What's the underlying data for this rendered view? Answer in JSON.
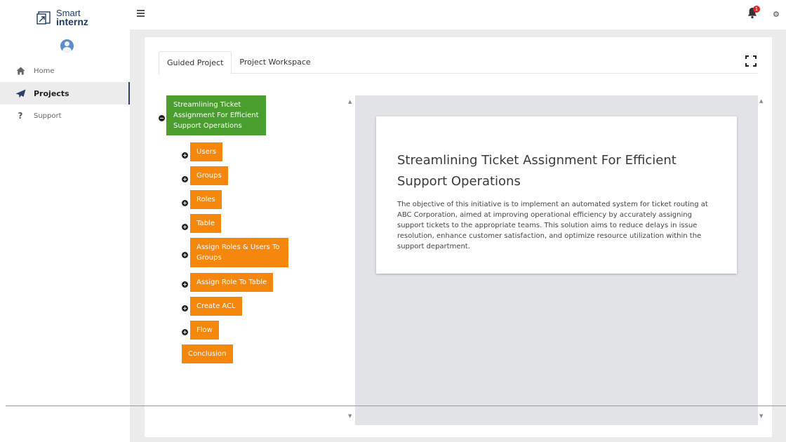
{
  "app": {
    "logo_line1": "Smart",
    "logo_line2": "internz"
  },
  "sidebar": {
    "items": [
      {
        "label": "Home",
        "icon": "home-icon"
      },
      {
        "label": "Projects",
        "icon": "paper-plane-icon",
        "active": true
      },
      {
        "label": "Support",
        "icon": "question-mark-icon"
      }
    ]
  },
  "topbar": {
    "notification_count": "1"
  },
  "tabs": [
    {
      "label": "Guided Project",
      "active": true
    },
    {
      "label": "Project Workspace",
      "active": false
    }
  ],
  "tree": {
    "root": {
      "label": "Streamlining Ticket Assignment For Efficient Support Operations",
      "toggle": "−"
    },
    "children": [
      {
        "label": "Users",
        "toggle": "+"
      },
      {
        "label": "Groups",
        "toggle": "+"
      },
      {
        "label": "Roles",
        "toggle": "+"
      },
      {
        "label": "Table",
        "toggle": "+"
      },
      {
        "label": "Assign Roles & Users To Groups",
        "toggle": "+"
      },
      {
        "label": "Assign Role To Table",
        "toggle": "+"
      },
      {
        "label": "Create ACL",
        "toggle": "+"
      },
      {
        "label": "Flow",
        "toggle": "+"
      },
      {
        "label": "Conclusion",
        "toggle": ""
      }
    ]
  },
  "document": {
    "title": "Streamlining Ticket Assignment For Efficient Support Operations",
    "body": "The objective of this initiative is to implement an automated system for ticket routing at ABC Corporation, aimed at improving operational efficiency by accurately assigning support tickets to the appropriate teams. This solution aims to reduce delays in issue resolution, enhance customer satisfaction, and optimize resource utilization within the support department."
  },
  "colors": {
    "root_node": "#4a9e2e",
    "child_node": "#f5870c",
    "badge": "#d9262c",
    "sidebar_active_bar": "#2a3f6b"
  }
}
